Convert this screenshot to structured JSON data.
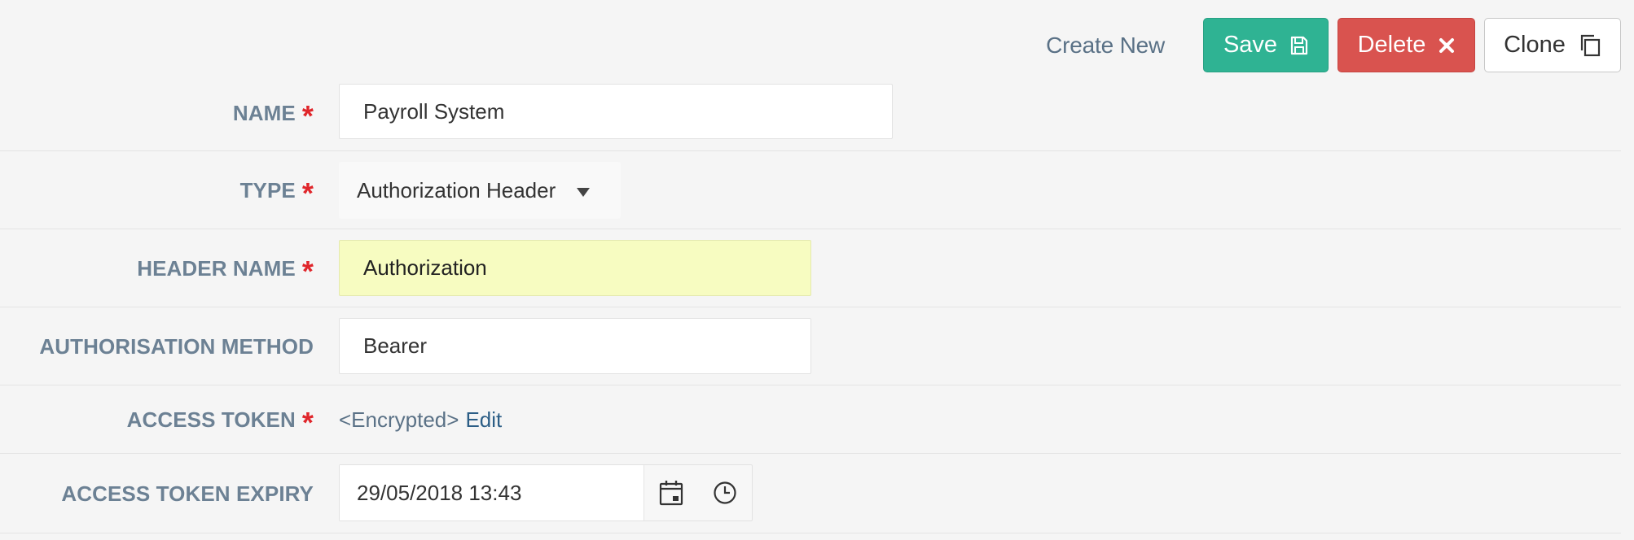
{
  "toolbar": {
    "create_new_label": "Create New",
    "save_label": "Save",
    "delete_label": "Delete",
    "clone_label": "Clone"
  },
  "colors": {
    "save": "#2fb393",
    "delete": "#d9534f",
    "required_asterisk": "#e0262b",
    "label": "#6c8194",
    "highlight_field": "#f7fcc1"
  },
  "form": {
    "name": {
      "label": "NAME",
      "required": true,
      "value": "Payroll System"
    },
    "type": {
      "label": "TYPE",
      "required": true,
      "value": "Authorization Header"
    },
    "header_name": {
      "label": "HEADER NAME",
      "required": true,
      "value": "Authorization"
    },
    "auth_method": {
      "label": "AUTHORISATION METHOD",
      "required": false,
      "value": "Bearer"
    },
    "access_token": {
      "label": "ACCESS TOKEN",
      "required": true,
      "value": "<Encrypted>",
      "edit_label": "Edit"
    },
    "access_token_expiry": {
      "label": "ACCESS TOKEN EXPIRY",
      "required": false,
      "value": "29/05/2018 13:43"
    }
  },
  "icons": {
    "save": "floppy-disk-icon",
    "delete": "x-icon",
    "clone": "copy-icon",
    "type_dropdown": "caret-down-icon",
    "date": "calendar-icon",
    "time": "clock-icon"
  }
}
